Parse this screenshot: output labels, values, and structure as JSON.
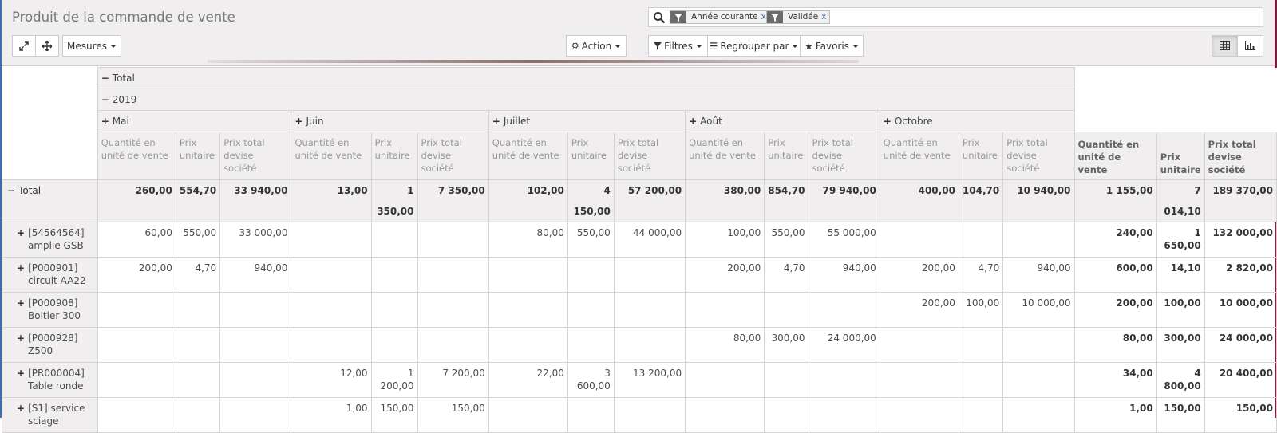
{
  "title": "Produit de la commande de vente",
  "search": {
    "facets": [
      {
        "label": "Année courante",
        "remove": "x"
      },
      {
        "label": "Validée",
        "remove": "x"
      }
    ]
  },
  "toolbar": {
    "measures_label": "Mesures",
    "action_label": "Action",
    "filters_label": "Filtres",
    "groupby_label": "Regrouper par",
    "favorites_label": "Favoris",
    "active_view": "pivot"
  },
  "pivot": {
    "col_total": "Total",
    "year": "2019",
    "months": [
      "Mai",
      "Juin",
      "Juillet",
      "Août",
      "Octobre"
    ],
    "measures": [
      "Quantité en unité de vente",
      "Prix unitaire",
      "Prix total devise société"
    ],
    "total_measures": [
      "Quantité en unité de vente",
      "Prix unitaire",
      "Prix total devise société"
    ],
    "total_row": {
      "label": "Total",
      "values": [
        "260,00",
        "554,70",
        "33 940,00",
        "13,00",
        "1 350,00",
        "7 350,00",
        "102,00",
        "4 150,00",
        "57 200,00",
        "380,00",
        "854,70",
        "79 940,00",
        "400,00",
        "104,70",
        "10 940,00"
      ],
      "totals": [
        "1 155,00",
        "7 014,10",
        "189 370,00"
      ]
    },
    "rows": [
      {
        "code": "[54564564]",
        "name": "amplie GSB",
        "values": [
          "60,00",
          "550,00",
          "33 000,00",
          "",
          "",
          "",
          "80,00",
          "550,00",
          "44 000,00",
          "100,00",
          "550,00",
          "55 000,00",
          "",
          "",
          ""
        ],
        "totals": [
          "240,00",
          "1 650,00",
          "132 000,00"
        ]
      },
      {
        "code": "[P000901]",
        "name": "circuit AA22",
        "values": [
          "200,00",
          "4,70",
          "940,00",
          "",
          "",
          "",
          "",
          "",
          "",
          "200,00",
          "4,70",
          "940,00",
          "200,00",
          "4,70",
          "940,00"
        ],
        "totals": [
          "600,00",
          "14,10",
          "2 820,00"
        ]
      },
      {
        "code": "[P000908]",
        "name": "Boitier 300",
        "values": [
          "",
          "",
          "",
          "",
          "",
          "",
          "",
          "",
          "",
          "",
          "",
          "",
          "200,00",
          "100,00",
          "10 000,00"
        ],
        "totals": [
          "200,00",
          "100,00",
          "10 000,00"
        ]
      },
      {
        "code": "[P000928]",
        "name": "Z500",
        "values": [
          "",
          "",
          "",
          "",
          "",
          "",
          "",
          "",
          "",
          "80,00",
          "300,00",
          "24 000,00",
          "",
          "",
          ""
        ],
        "totals": [
          "80,00",
          "300,00",
          "24 000,00"
        ]
      },
      {
        "code": "[PR000004]",
        "name": "Table ronde",
        "values": [
          "",
          "",
          "",
          "12,00",
          "1 200,00",
          "7 200,00",
          "22,00",
          "3 600,00",
          "13 200,00",
          "",
          "",
          "",
          "",
          "",
          ""
        ],
        "totals": [
          "34,00",
          "4 800,00",
          "20 400,00"
        ]
      },
      {
        "code": "[S1] service",
        "name": "sciage",
        "values": [
          "",
          "",
          "",
          "1,00",
          "150,00",
          "150,00",
          "",
          "",
          "",
          "",
          "",
          "",
          "",
          "",
          ""
        ],
        "totals": [
          "1,00",
          "150,00",
          "150,00"
        ]
      }
    ]
  }
}
